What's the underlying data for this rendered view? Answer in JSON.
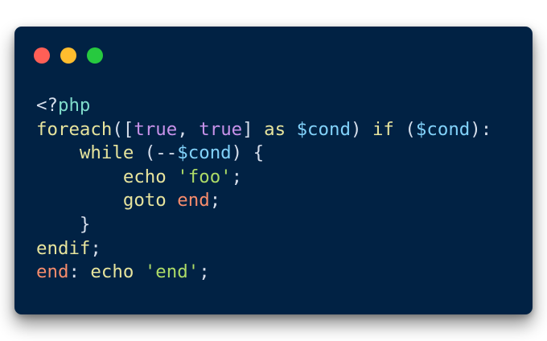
{
  "window": {
    "background": "#012244",
    "controls": [
      {
        "name": "close",
        "color": "#ff5f56"
      },
      {
        "name": "minimize",
        "color": "#ffbd2e"
      },
      {
        "name": "maximize",
        "color": "#27c93f"
      }
    ]
  },
  "code": {
    "lines": [
      [
        {
          "t": "<?",
          "c": "plain"
        },
        {
          "t": "php",
          "c": "tag"
        }
      ],
      [
        {
          "t": "foreach",
          "c": "kw"
        },
        {
          "t": "([",
          "c": "plain"
        },
        {
          "t": "true",
          "c": "const"
        },
        {
          "t": ", ",
          "c": "plain"
        },
        {
          "t": "true",
          "c": "const"
        },
        {
          "t": "] ",
          "c": "plain"
        },
        {
          "t": "as",
          "c": "kw"
        },
        {
          "t": " ",
          "c": "plain"
        },
        {
          "t": "$cond",
          "c": "var"
        },
        {
          "t": ") ",
          "c": "plain"
        },
        {
          "t": "if",
          "c": "kw"
        },
        {
          "t": " (",
          "c": "plain"
        },
        {
          "t": "$cond",
          "c": "var"
        },
        {
          "t": "):",
          "c": "plain"
        }
      ],
      [
        {
          "t": "    ",
          "c": "plain"
        },
        {
          "t": "while",
          "c": "kw"
        },
        {
          "t": " (--",
          "c": "plain"
        },
        {
          "t": "$cond",
          "c": "var"
        },
        {
          "t": ") {",
          "c": "plain"
        }
      ],
      [
        {
          "t": "        ",
          "c": "plain"
        },
        {
          "t": "echo",
          "c": "kw"
        },
        {
          "t": " ",
          "c": "plain"
        },
        {
          "t": "'foo'",
          "c": "str"
        },
        {
          "t": ";",
          "c": "plain"
        }
      ],
      [
        {
          "t": "        ",
          "c": "plain"
        },
        {
          "t": "goto",
          "c": "kw"
        },
        {
          "t": " ",
          "c": "plain"
        },
        {
          "t": "end",
          "c": "label"
        },
        {
          "t": ";",
          "c": "plain"
        }
      ],
      [
        {
          "t": "    ",
          "c": "plain"
        },
        {
          "t": "}",
          "c": "plain"
        }
      ],
      [
        {
          "t": "endif",
          "c": "kw"
        },
        {
          "t": ";",
          "c": "plain"
        }
      ],
      [
        {
          "t": "end",
          "c": "label"
        },
        {
          "t": ": ",
          "c": "plain"
        },
        {
          "t": "echo",
          "c": "kw"
        },
        {
          "t": " ",
          "c": "plain"
        },
        {
          "t": "'end'",
          "c": "str"
        },
        {
          "t": ";",
          "c": "plain"
        }
      ]
    ]
  }
}
